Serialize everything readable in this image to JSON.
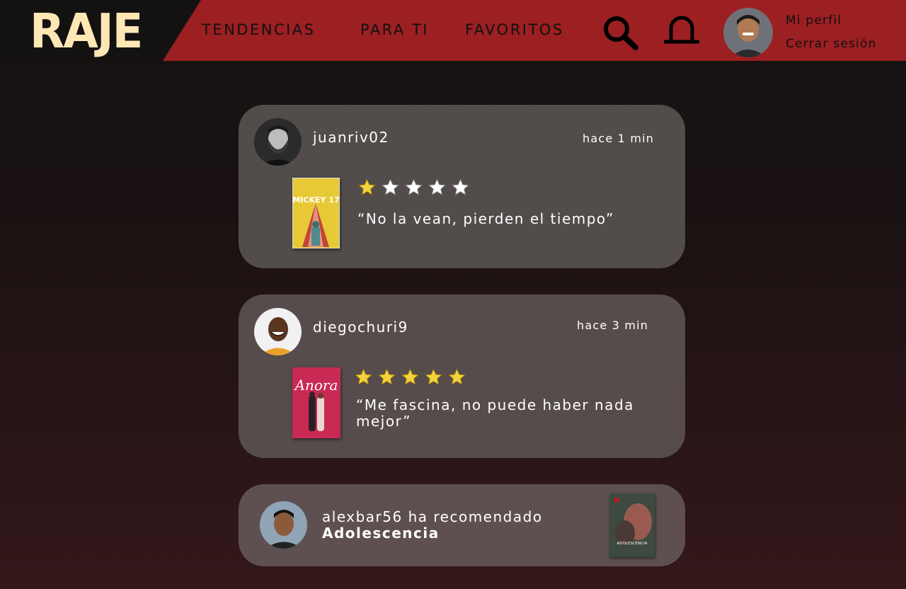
{
  "app": {
    "logo": "RAJE",
    "accent": "#9c1f22",
    "logo_color": "#fde8b5"
  },
  "nav": {
    "items": [
      "TENDENCIAS",
      "PARA TI",
      "FAVORITOS"
    ]
  },
  "header_icons": [
    "search-icon",
    "bell-icon"
  ],
  "profile": {
    "my_profile": "Mi perfil",
    "logout": "Cerrar sesión"
  },
  "feed": [
    {
      "user": "juanriv02",
      "time": "hace 1 min",
      "movie": "Mickey 17",
      "rating": 1,
      "max_rating": 5,
      "quote": "“No la vean, pierden el tiempo”",
      "poster_text": "MICKEY 17"
    },
    {
      "user": "diegochuri9",
      "time": "hace 3 min",
      "movie": "Anora",
      "rating": 5,
      "max_rating": 5,
      "quote": "“Me fascina, no puede haber nada mejor”",
      "poster_text": "Anora"
    }
  ],
  "recommendation": {
    "user": "alexbar56",
    "action": "ha recomendado",
    "title": "Adolescencia",
    "poster_text": "ADOLESCENCIA",
    "poster_badge": "N"
  },
  "colors": {
    "star_on": "#f2d23a",
    "star_off": "#ffffff",
    "card": "#524b4a"
  }
}
